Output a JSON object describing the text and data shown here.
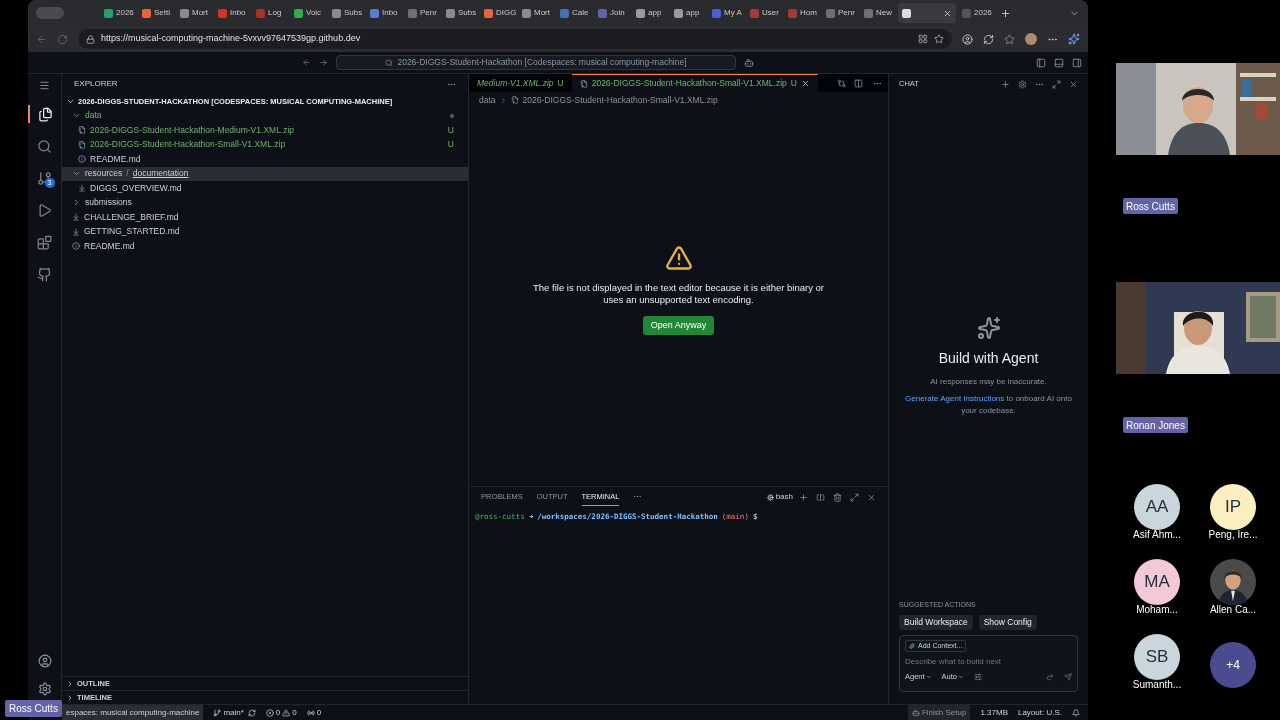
{
  "browser": {
    "tabs": [
      {
        "title": "2026",
        "color": "#21a366",
        "selected": false
      },
      {
        "title": "Setti",
        "color": "#e8623a",
        "selected": false
      },
      {
        "title": "Mort",
        "color": "#8a8a8a",
        "selected": false
      },
      {
        "title": "Inbo",
        "color": "#d93025",
        "selected": false
      },
      {
        "title": "Log",
        "color": "#a8322b",
        "selected": false
      },
      {
        "title": "Voic",
        "color": "#34a853",
        "selected": false
      },
      {
        "title": "Subs",
        "color": "#8a8a8a",
        "selected": false
      },
      {
        "title": "Inbo",
        "color": "#5a7bd6",
        "selected": false
      },
      {
        "title": "Penr",
        "color": "#6f6f6f",
        "selected": false
      },
      {
        "title": "Subs",
        "color": "#8a8a8a",
        "selected": false
      },
      {
        "title": "DIGG",
        "color": "#e8623a",
        "selected": false
      },
      {
        "title": "Mort",
        "color": "#8a8a8a",
        "selected": false
      },
      {
        "title": "Cale",
        "color": "#4a6fb5",
        "selected": false
      },
      {
        "title": "Join",
        "color": "#6264a7",
        "selected": false
      },
      {
        "title": "app",
        "color": "#9a9a9a",
        "selected": false
      },
      {
        "title": "app",
        "color": "#9a9a9a",
        "selected": false
      },
      {
        "title": "My A",
        "color": "#4a5fd6",
        "selected": false
      },
      {
        "title": "User",
        "color": "#a33a3a",
        "selected": false
      },
      {
        "title": "Hom",
        "color": "#a33a3a",
        "selected": false
      },
      {
        "title": "Penr",
        "color": "#6f6f6f",
        "selected": false
      },
      {
        "title": "New",
        "color": "#6f6f6f",
        "selected": false
      },
      {
        "color": "#dddddd",
        "selected": true
      },
      {
        "title": "2026",
        "color": "#555555",
        "selected": false
      }
    ],
    "url": "https://musical-computing-machine-5vxvv97647539gp.github.dev"
  },
  "title_bar": {
    "command_center": "2026-DIGGS-Student-Hackathon [Codespaces: musical computing-machine]"
  },
  "activity_bar": {
    "items": [
      {
        "kind": "files",
        "selected": true
      },
      {
        "kind": "search",
        "selected": false
      },
      {
        "kind": "source-control",
        "selected": false,
        "badge": "3"
      },
      {
        "kind": "run",
        "selected": false
      },
      {
        "kind": "extensions",
        "selected": false
      },
      {
        "kind": "github",
        "selected": false
      }
    ]
  },
  "explorer": {
    "title": "EXPLORER",
    "separator": "/",
    "root": {
      "label": "2026-DIGGS-STUDENT-HACKATHON [CODESPACES: MUSICAL COMPUTING-MACHINE]",
      "expanded": true,
      "children": [
        {
          "kind": "folder",
          "label": "data",
          "expanded": true,
          "untracked": true,
          "selected": false,
          "dot": true,
          "children": [
            {
              "kind": "zip",
              "label": "2026-DIGGS-Student-Hackathon-Medium-V1.XML.zip",
              "untracked": true,
              "selected": false,
              "badge": "U"
            },
            {
              "kind": "zip",
              "label": "2026-DIGGS-Student-Hackathon-Small-V1.XML.zip",
              "untracked": true,
              "selected": false,
              "badge": "U"
            },
            {
              "kind": "info",
              "label": "README.md",
              "untracked": false,
              "selected": false
            }
          ]
        },
        {
          "kind": "folder",
          "label": "resources",
          "sublabel": "documentation",
          "expanded": true,
          "untracked": false,
          "selected": true,
          "children": [
            {
              "kind": "md",
              "label": "DIGGS_OVERVIEW.md",
              "untracked": false,
              "selected": false
            }
          ]
        },
        {
          "kind": "folder",
          "label": "submissions",
          "expanded": false,
          "untracked": false,
          "selected": false
        },
        {
          "kind": "md",
          "label": "CHALLENGE_BRIEF.md",
          "untracked": false,
          "selected": false
        },
        {
          "kind": "md",
          "label": "GETTING_STARTED.md",
          "untracked": false,
          "selected": false
        },
        {
          "kind": "info",
          "label": "README.md",
          "untracked": false,
          "selected": false
        }
      ]
    },
    "sections": [
      {
        "title": "OUTLINE",
        "expanded": false
      },
      {
        "title": "TIMELINE",
        "expanded": false
      }
    ]
  },
  "editor": {
    "tabs": [
      {
        "label": "Medium-V1.XML.zip",
        "badge": "U",
        "preview": true,
        "selected": false
      },
      {
        "label": "2026-DIGGS-Student-Hackathon-Small-V1.XML.zip",
        "badge": "U",
        "preview": false,
        "selected": true
      }
    ],
    "breadcrumb": [
      "data",
      "2026-DIGGS-Student-Hackathon-Small-V1.XML.zip"
    ],
    "message": "The file is not displayed in the text editor because it is either binary or uses an unsupported text encoding.",
    "button": "Open Anyway"
  },
  "panel": {
    "tabs": [
      {
        "label": "PROBLEMS",
        "selected": false
      },
      {
        "label": "OUTPUT",
        "selected": false
      },
      {
        "label": "TERMINAL",
        "selected": true
      }
    ],
    "more": "···",
    "shell": "bash",
    "terminal": {
      "user": "@ross-cutts",
      "arrow": "➜",
      "path": "/workspaces/2026-DIGGS-Student-Hackathon",
      "branch": "(main)",
      "prompt": "$"
    }
  },
  "chat": {
    "title": "CHAT",
    "heading": "Build with Agent",
    "note": "AI responses may be inaccurate.",
    "link": "Generate Agent Instructions",
    "link_tail": " to onboard AI onto your codebase.",
    "suggested_title": "SUGGESTED ACTIONS",
    "actions": [
      "Build Workspace",
      "Show Config"
    ],
    "add_context": "Add Context...",
    "placeholder": "Describe what to build next",
    "mode": "Agent",
    "model": "Auto"
  },
  "status_bar": {
    "remote": "espaces: musical computing-machine",
    "branch": "main*",
    "errors": "0",
    "warnings": "0",
    "ports": "0",
    "setup": "Finish Setup",
    "size": "1.37MB",
    "layout": "Layout: U.S."
  },
  "meeting": {
    "self_label": "Ross Cutts",
    "videos": [
      {
        "name": "Ross Cutts",
        "kind": "picture"
      },
      {
        "name": "Ronan Jones",
        "kind": "picture"
      }
    ],
    "participants": [
      {
        "kind": "initials",
        "initials": "AA",
        "name": "Asif Ahm...",
        "color": "#c9d6dc"
      },
      {
        "kind": "initials",
        "initials": "IP",
        "name": "Peng, Ire...",
        "color": "#fbeec0"
      },
      {
        "kind": "initials",
        "initials": "MA",
        "name": "Moham...",
        "color": "#f3c9d8"
      },
      {
        "name": "Allen Ca..."
      },
      {
        "kind": "initials",
        "initials": "SB",
        "name": "Sumanth...",
        "color": "#c9d6dc"
      },
      {
        "kind": "more",
        "label": "+4",
        "color": "#4b4b8f"
      }
    ]
  }
}
